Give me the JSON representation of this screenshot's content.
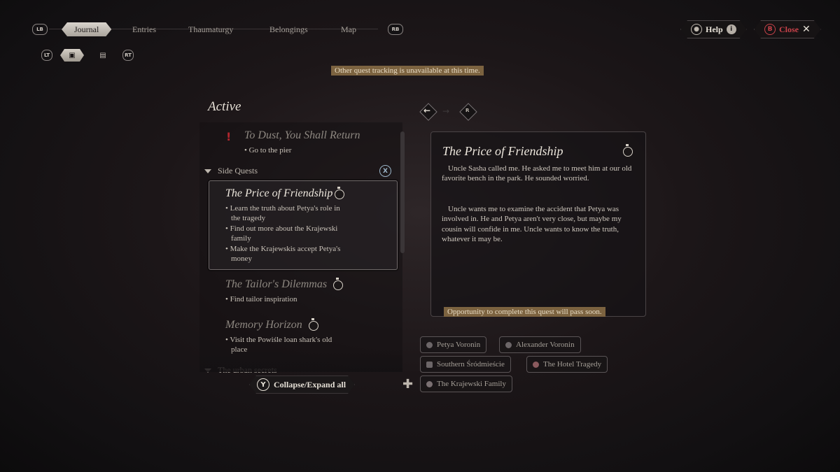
{
  "nav": {
    "lb": "LB",
    "rb": "RB",
    "tabs": [
      {
        "label": "Journal",
        "active": true
      },
      {
        "label": "Entries"
      },
      {
        "label": "Thaumaturgy"
      },
      {
        "label": "Belongings"
      },
      {
        "label": "Map"
      }
    ]
  },
  "subnav": {
    "lt": "LT",
    "rt": "RT"
  },
  "top_right": {
    "help_label": "Help",
    "close_label": "Close",
    "b_key": "B"
  },
  "banner_tracking": "Other quest tracking is unavailable at this time.",
  "list": {
    "heading": "Active",
    "main_quest": {
      "title": "To Dust, You Shall Return",
      "objectives": [
        "Go to the pier"
      ]
    },
    "side_section": "Side Quests",
    "side_section_key": "X",
    "quests": [
      {
        "title": "The Price of Friendship",
        "objectives": [
          "Learn the truth about Petya's role in the tragedy",
          "Find out more about the Krajewski family",
          "Make the Krajewskis accept Petya's money"
        ]
      },
      {
        "title": "The Tailor's Dilemmas",
        "objectives": [
          "Find tailor inspiration"
        ]
      },
      {
        "title": "Memory Horizon",
        "objectives": [
          "Visit the Powiśle loan shark's old place"
        ]
      }
    ],
    "next_section": "The urban secrets"
  },
  "collapse": {
    "key": "Y",
    "label": "Collapse/Expand all"
  },
  "detail": {
    "title": "The Price of Friendship",
    "para1": "Uncle Sasha called me. He asked me to meet him at our old favorite bench in the park. He sounded worried.",
    "para2": "Uncle wants me to examine the accident that Petya was involved in. He and Petya aren't very close, but maybe my cousin will confide in me. Uncle wants to know the truth, whatever it may be.",
    "warning": "Opportunity to complete this quest will pass soon."
  },
  "tags": [
    "Petya Voronin",
    "Alexander Voronin",
    "Southern Śródmieście",
    "The Hotel Tragedy",
    "The Krajewski Family"
  ],
  "colors": {
    "accent_banner": "#7c6340",
    "alert_red": "#b3262e",
    "close_red": "#c8424a"
  }
}
